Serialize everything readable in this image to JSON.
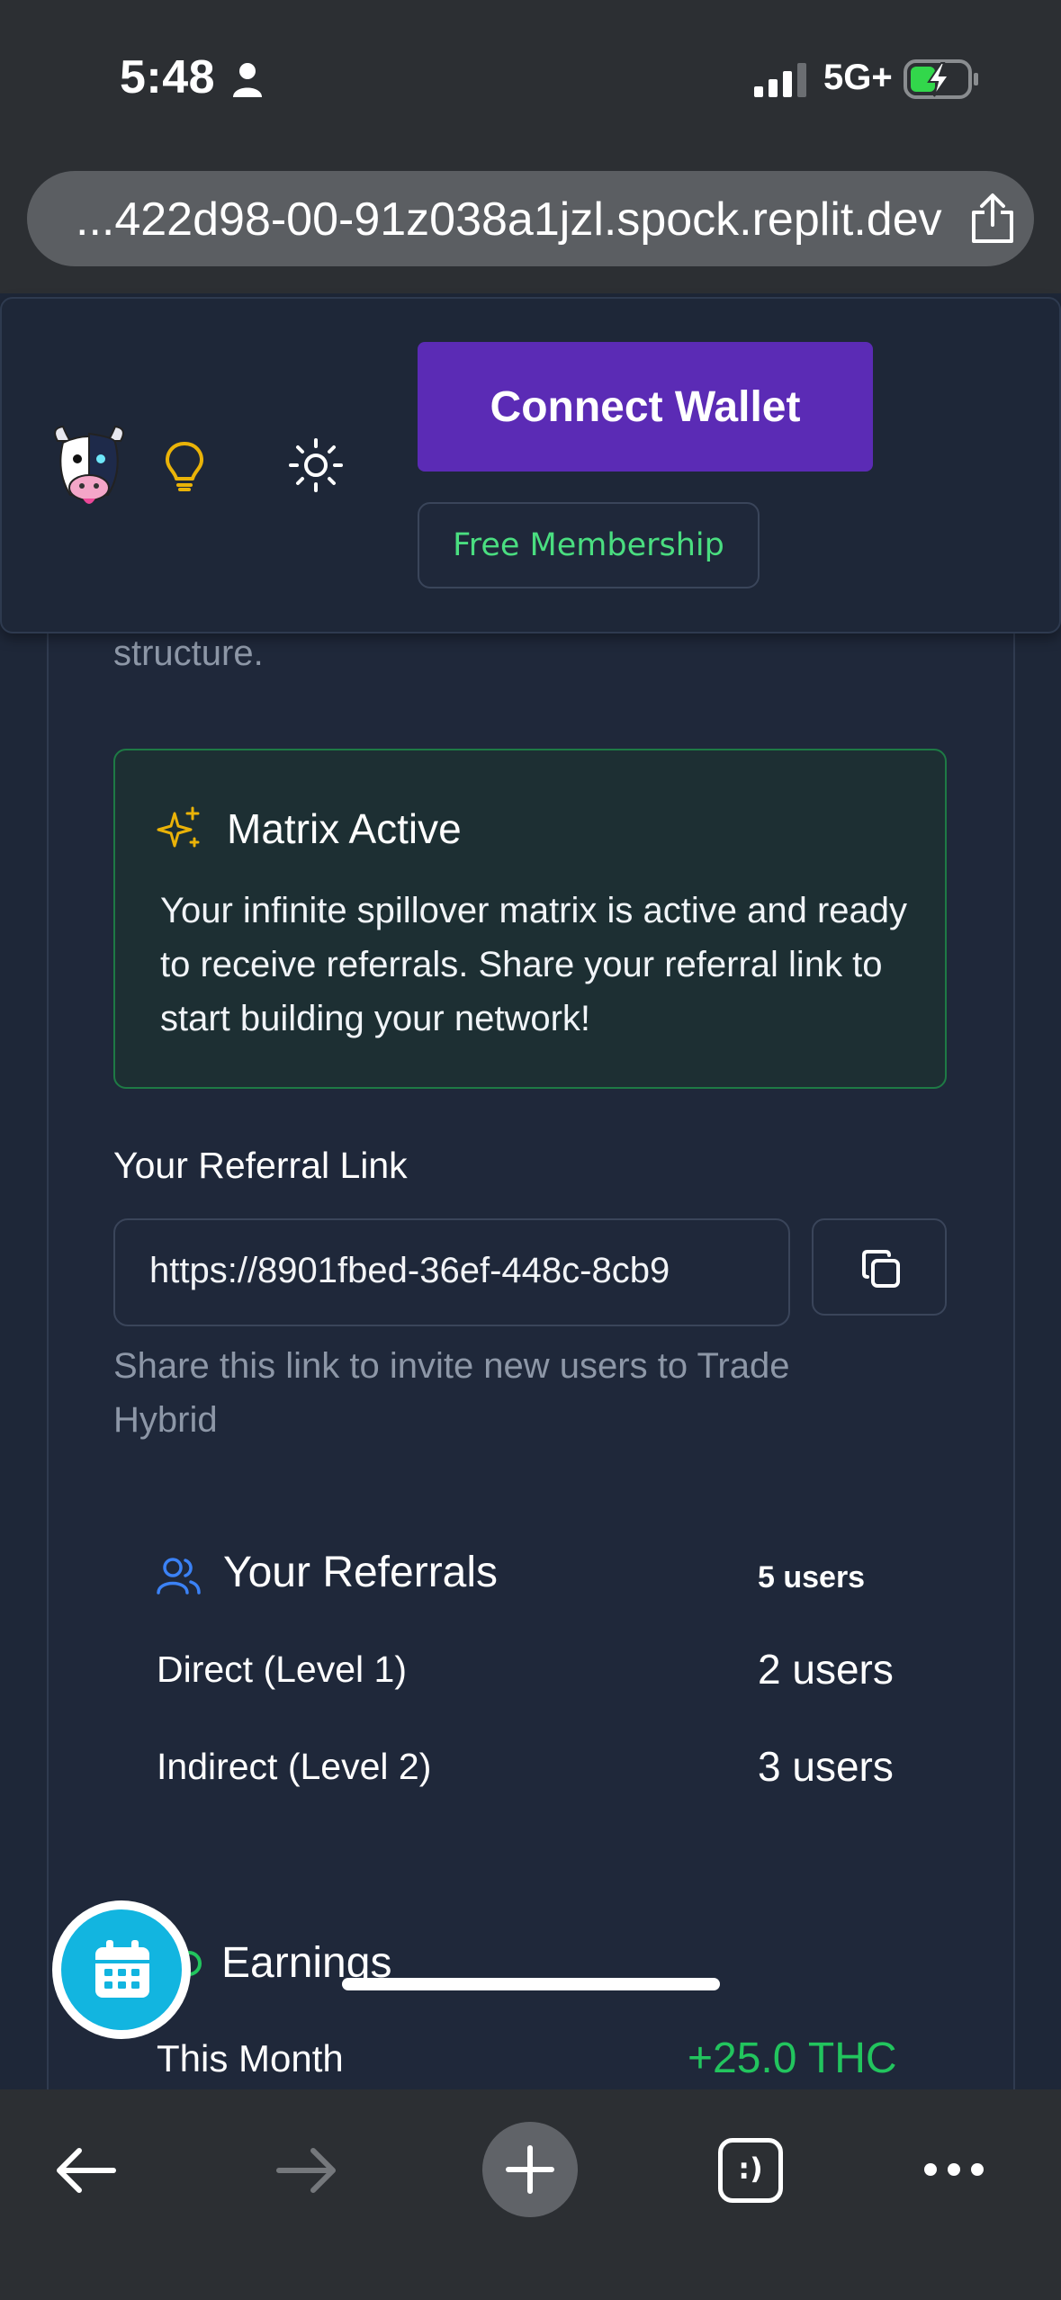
{
  "status_bar": {
    "time": "5:48",
    "network": "5G+",
    "battery_level": 0.45
  },
  "browser": {
    "url": "...422d98-00-91z038a1jzl.spock.replit.dev",
    "tabs_label": ":)"
  },
  "header": {
    "connect_wallet_label": "Connect Wallet",
    "membership_label": "Free Membership"
  },
  "content": {
    "clipped_text": "structure.",
    "alert": {
      "title": "Matrix Active",
      "body": "Your infinite spillover matrix is active and ready to receive referrals. Share your referral link to start building your network!"
    },
    "referral_link": {
      "label": "Your Referral Link",
      "value": "https://8901fbed-36ef-448c-8cb9",
      "help": "Share this link to invite new users to Trade Hybrid"
    },
    "referrals": {
      "title": "Your Referrals",
      "total": "5 users",
      "rows": [
        {
          "label": "Direct (Level 1)",
          "value": "2 users"
        },
        {
          "label": "Indirect (Level 2)",
          "value": "3 users"
        }
      ]
    },
    "earnings": {
      "title": "Earnings",
      "this_month_label": "This Month",
      "this_month_value": "+25.0 THC"
    }
  },
  "colors": {
    "accent_purple": "#5b2bb5",
    "success_green": "#22c55e",
    "membership_green": "#4ade80",
    "alert_border": "#1e7a45",
    "background": "#1e2738",
    "fab_cyan": "#12b5e0"
  },
  "icons": {
    "share": "share-icon",
    "sparkle": "sparkles-icon",
    "copy": "copy-icon",
    "users": "users-icon",
    "bulb": "lightbulb-icon",
    "sun": "sun-icon",
    "calendar": "calendar-icon"
  }
}
